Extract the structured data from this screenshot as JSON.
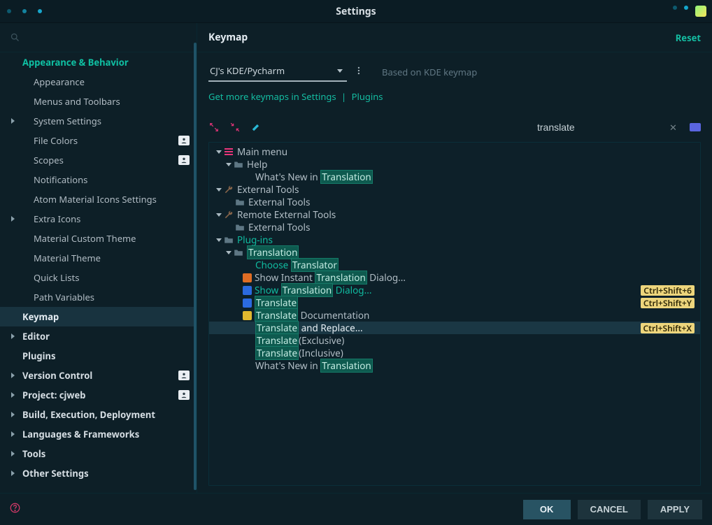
{
  "window": {
    "title": "Settings"
  },
  "sidebar": {
    "search_placeholder": "",
    "items": [
      {
        "label": "Appearance & Behavior",
        "kind": "top",
        "chev": false
      },
      {
        "label": "Appearance",
        "kind": "child"
      },
      {
        "label": "Menus and Toolbars",
        "kind": "child"
      },
      {
        "label": "System Settings",
        "kind": "child",
        "chev": true
      },
      {
        "label": "File Colors",
        "kind": "child",
        "badge": true
      },
      {
        "label": "Scopes",
        "kind": "child",
        "badge": true
      },
      {
        "label": "Notifications",
        "kind": "child"
      },
      {
        "label": "Atom Material Icons Settings",
        "kind": "child"
      },
      {
        "label": "Extra Icons",
        "kind": "child",
        "chev": true
      },
      {
        "label": "Material Custom Theme",
        "kind": "child"
      },
      {
        "label": "Material Theme",
        "kind": "child"
      },
      {
        "label": "Quick Lists",
        "kind": "child"
      },
      {
        "label": "Path Variables",
        "kind": "child"
      },
      {
        "label": "Keymap",
        "kind": "selected"
      },
      {
        "label": "Editor",
        "kind": "section",
        "chev": true
      },
      {
        "label": "Plugins",
        "kind": "section"
      },
      {
        "label": "Version Control",
        "kind": "section",
        "chev": true,
        "badge": true
      },
      {
        "label": "Project: cjweb",
        "kind": "section",
        "chev": true,
        "badge": true
      },
      {
        "label": "Build, Execution, Deployment",
        "kind": "section",
        "chev": true
      },
      {
        "label": "Languages & Frameworks",
        "kind": "section",
        "chev": true
      },
      {
        "label": "Tools",
        "kind": "section",
        "chev": true
      },
      {
        "label": "Other Settings",
        "kind": "section",
        "chev": true
      }
    ]
  },
  "header": {
    "title": "Keymap",
    "reset": "Reset"
  },
  "selector": {
    "value": "CJ's KDE/Pycharm",
    "based_on": "Based on KDE keymap",
    "link_a": "Get more keymaps in Settings",
    "link_b": "Plugins"
  },
  "search": {
    "value": "translate"
  },
  "tree": {
    "mainmenu": "Main menu",
    "help": "Help",
    "help_whats_new_pre": "What's New in ",
    "help_whats_new_mark": "Translation",
    "external_tools": "External Tools",
    "external_tools_item": "External Tools",
    "remote_tools": "Remote External Tools",
    "remote_tools_item": "External Tools",
    "plugins": "Plug-ins",
    "translation": "Translation",
    "choose_pre": "Choose ",
    "choose_mark": "Translator",
    "instant_pre": "Show Instant ",
    "instant_mark": "Translation",
    "instant_post": " Dialog...",
    "showdlg_pre": "Show ",
    "showdlg_mark": "Translation",
    "showdlg_post": " Dialog...",
    "showdlg_key": "Ctrl+Shift+6",
    "translate": "Translate",
    "translate_key": "Ctrl+Shift+Y",
    "doc_mark": "Translate",
    "doc_post": " Documentation",
    "replace_mark": "Translate",
    "replace_post": " and Replace...",
    "replace_key": "Ctrl+Shift+X",
    "excl_mark": "Translate",
    "excl_post": "(Exclusive)",
    "incl_mark": "Translate",
    "incl_post": "(Inclusive)",
    "whats2_pre": "What's New in ",
    "whats2_mark": "Translation"
  },
  "footer": {
    "ok": "OK",
    "cancel": "CANCEL",
    "apply": "APPLY"
  }
}
